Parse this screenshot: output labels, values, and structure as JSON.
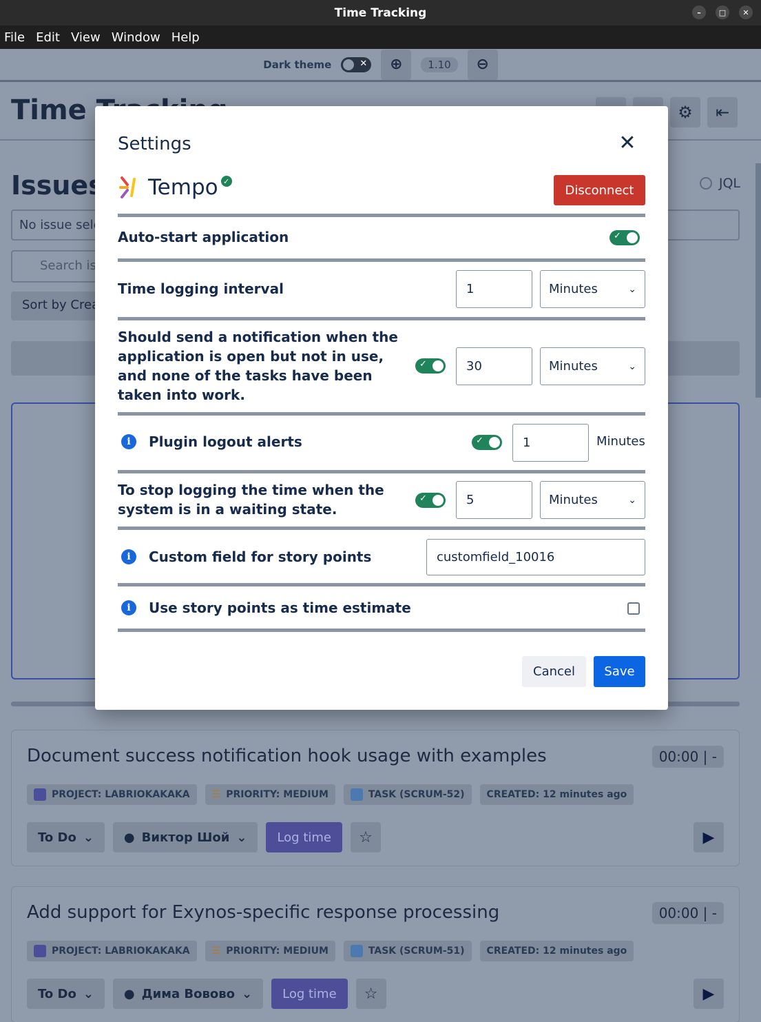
{
  "window": {
    "title": "Time Tracking"
  },
  "menu": [
    "File",
    "Edit",
    "View",
    "Window",
    "Help"
  ],
  "zoombar": {
    "dark_theme_label": "Dark theme",
    "zoom_value": "1.10"
  },
  "app": {
    "title": "Time Tracking"
  },
  "issues": {
    "title": "Issues",
    "filter_options": [
      "JQL"
    ],
    "issue_select_placeholder": "No issue selected",
    "search_placeholder": "Search issues",
    "sort_label": "Sort by Created"
  },
  "cards": [
    {
      "title": "Document success notification hook usage with examples",
      "time": "00:00 | -",
      "tags": [
        "PROJECT: LABRIOKAKAKA",
        "PRIORITY: MEDIUM",
        "TASK (SCRUM-52)",
        "CREATED: 12 minutes ago"
      ],
      "status": "To Do",
      "assignee": "Виктор Шой",
      "log_label": "Log time"
    },
    {
      "title": "Add support for Exynos-specific response processing",
      "time": "00:00 | -",
      "tags": [
        "PROJECT: LABRIOKAKAKA",
        "PRIORITY: MEDIUM",
        "TASK (SCRUM-51)",
        "CREATED: 12 minutes ago"
      ],
      "status": "To Do",
      "assignee": "Дима Вововo",
      "log_label": "Log time"
    }
  ],
  "settings": {
    "title": "Settings",
    "plugin_name": "Tempo",
    "disconnect_label": "Disconnect",
    "auto_start": {
      "label": "Auto-start application",
      "enabled": true
    },
    "interval": {
      "label": "Time logging interval",
      "value": "1",
      "unit": "Minutes"
    },
    "idle_notification": {
      "label": "Should send a notification when the application is open but not in use, and none of the tasks have been taken into work.",
      "enabled": true,
      "value": "30",
      "unit": "Minutes"
    },
    "logout_alerts": {
      "label": "Plugin logout alerts",
      "enabled": true,
      "value": "1",
      "unit": "Minutes"
    },
    "waiting_stop": {
      "label": "To stop logging the time when the system is in a waiting state.",
      "enabled": true,
      "value": "5",
      "unit": "Minutes"
    },
    "story_field": {
      "label": "Custom field for story points",
      "value": "customfield_10016"
    },
    "story_estimate": {
      "label": "Use story points as time estimate",
      "checked": false
    },
    "cancel_label": "Cancel",
    "save_label": "Save"
  },
  "colors": {
    "accent": "#0c66e4",
    "danger": "#c9372c",
    "success": "#1f845a"
  }
}
